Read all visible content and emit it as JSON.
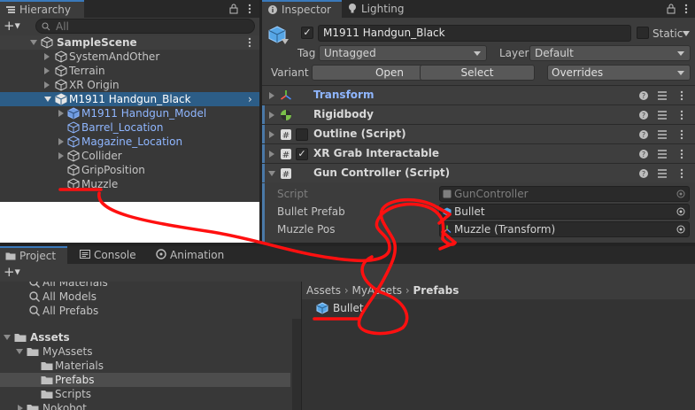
{
  "hierarchy": {
    "tab_label": "Hierarchy",
    "search_placeholder": "All",
    "scene_name": "SampleScene",
    "items": [
      {
        "label": "SystemAndOther"
      },
      {
        "label": "Terrain"
      },
      {
        "label": "XR Origin"
      },
      {
        "label": "M1911 Handgun_Black"
      },
      {
        "label": "M1911 Handgun_Model"
      },
      {
        "label": "Barrel_Location"
      },
      {
        "label": "Magazine_Location"
      },
      {
        "label": "Collider"
      },
      {
        "label": "GripPosition"
      },
      {
        "label": "Muzzle"
      }
    ]
  },
  "inspector": {
    "tabs": [
      {
        "label": "Inspector"
      },
      {
        "label": "Lighting"
      }
    ],
    "object_name": "M1911 Handgun_Black",
    "static_label": "Static",
    "tag_label": "Tag",
    "tag_value": "Untagged",
    "layer_label": "Layer",
    "layer_value": "Default",
    "variant_label": "Variant",
    "open_label": "Open",
    "select_label": "Select",
    "overrides_label": "Overrides",
    "components": [
      {
        "label": "Transform"
      },
      {
        "label": "Rigidbody"
      },
      {
        "label": "Outline (Script)"
      },
      {
        "label": "XR Grab Interactable"
      },
      {
        "label": "Gun Controller (Script)"
      }
    ],
    "fields": {
      "script_label": "Script",
      "script_value": "GunController",
      "bullet_prefab_label": "Bullet Prefab",
      "bullet_prefab_value": "Bullet",
      "muzzle_pos_label": "Muzzle Pos",
      "muzzle_pos_value": "Muzzle (Transform)"
    }
  },
  "project": {
    "tabs": [
      {
        "label": "Project"
      },
      {
        "label": "Console"
      },
      {
        "label": "Animation"
      }
    ],
    "favorites": [
      {
        "label": "All Materials"
      },
      {
        "label": "All Models"
      },
      {
        "label": "All Prefabs"
      }
    ],
    "tree": [
      {
        "label": "Assets"
      },
      {
        "label": "MyAssets"
      },
      {
        "label": "Materials"
      },
      {
        "label": "Prefabs"
      },
      {
        "label": "Scripts"
      },
      {
        "label": "Nokobot"
      }
    ],
    "breadcrumb": [
      "Assets",
      "MyAssets",
      "Prefabs"
    ],
    "asset_name": "Bullet"
  },
  "colors": {
    "accent_blue": "#3a79bb",
    "selection": "#2c5d87",
    "annotation_red": "#ff0000",
    "prefab_blue": "#8fb6ff"
  }
}
